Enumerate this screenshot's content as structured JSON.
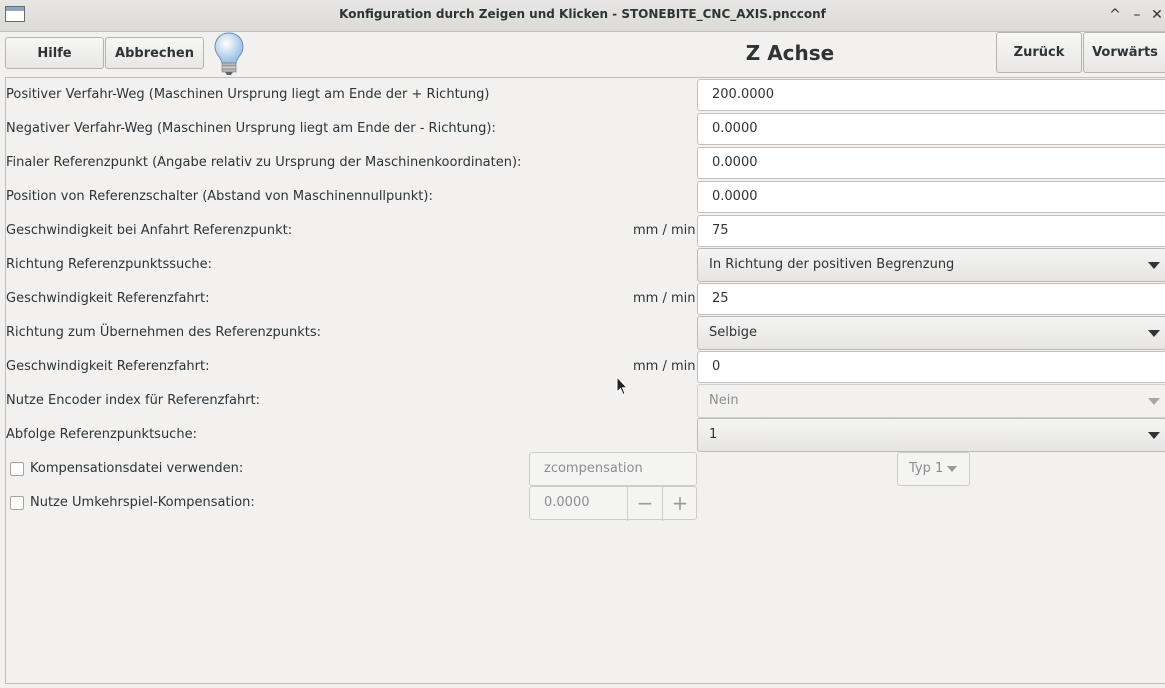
{
  "window": {
    "title": "Konfiguration durch Zeigen und Klicken - STONEBITE_CNC_AXIS.pncconf",
    "controls": {
      "minimize_icon": "^",
      "restore_icon": "–",
      "close_icon": "✕"
    }
  },
  "toolbar": {
    "help_label": "Hilfe",
    "cancel_label": "Abbrechen",
    "page_title": "Z Achse",
    "back_label": "Zurück",
    "forward_label": "Vorwärts"
  },
  "form": {
    "pos_travel": {
      "label": "Positiver Verfahr-Weg  (Maschinen Ursprung liegt am Ende der + Richtung)",
      "value": "200.0000"
    },
    "neg_travel": {
      "label": "Negativer Verfahr-Weg  (Maschinen Ursprung liegt am Ende der - Richtung):",
      "value": "0.0000"
    },
    "final_home": {
      "label": "Finaler Referenzpunkt   (Angabe relativ zu Ursprung der Maschinenkoordinaten):",
      "value": "0.0000"
    },
    "home_switch_pos": {
      "label": "Position von Referenzschalter (Abstand von Maschinennullpunkt):",
      "value": "0.0000"
    },
    "search_velocity": {
      "label": "Geschwindigkeit bei Anfahrt Referenzpunkt:",
      "unit": "mm / min",
      "value": "75"
    },
    "search_direction": {
      "label": "Richtung Referenzpunktssuche:",
      "value": "In Richtung der positiven Begrenzung"
    },
    "latch_velocity": {
      "label": "Geschwindigkeit Referenzfahrt:",
      "unit": "mm / min",
      "value": "25"
    },
    "latch_direction": {
      "label": "Richtung zum Übernehmen des Referenzpunkts:",
      "value": "Selbige"
    },
    "final_velocity": {
      "label": "Geschwindigkeit Referenzfahrt:",
      "unit": "mm / min",
      "value": "0"
    },
    "use_index": {
      "label": "Nutze Encoder index für Referenzfahrt:",
      "value": "Nein"
    },
    "home_sequence": {
      "label": "Abfolge Referenzpunktsuche:",
      "value": "1"
    },
    "comp_file": {
      "label": "Kompensationsdatei verwenden:",
      "checked": false,
      "placeholder": "zcompensation",
      "type_value": "Typ 1"
    },
    "backlash": {
      "label": "Nutze Umkehrspiel-Kompensation:",
      "checked": false,
      "value": "0.0000",
      "minus": "−",
      "plus": "+"
    }
  }
}
